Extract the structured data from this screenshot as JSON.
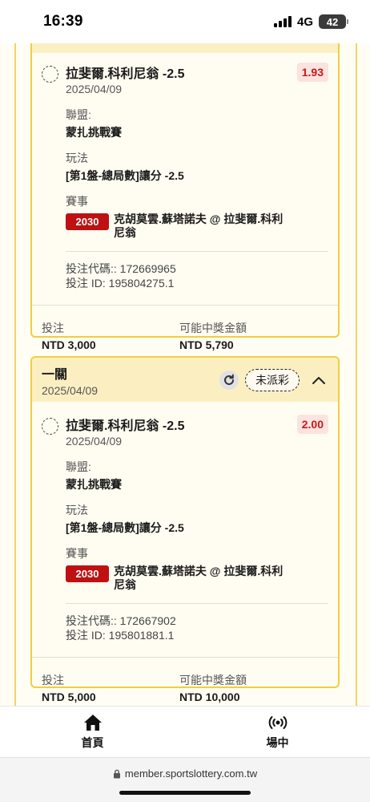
{
  "status_bar": {
    "time": "16:39",
    "network": "4G",
    "battery": "42"
  },
  "bets": [
    {
      "header_title": "",
      "header_date": "",
      "status": "",
      "selection": "拉斐爾.科利尼翁 -2.5",
      "date": "2025/04/09",
      "odds": "1.93",
      "league_label": "聯盟:",
      "league": "蒙扎挑戰賽",
      "market_label": "玩法",
      "market": "[第1盤-總局數]讓分 -2.5",
      "event_label": "賽事",
      "event_time": "2030",
      "event": "克胡莫雲.蘇塔諾夫 @ 拉斐爾.科利尼翁",
      "bet_code": "投注代碼:: 172669965",
      "bet_id": "投注 ID: 195804275.1",
      "stake_label": "投注",
      "stake": "NTD 3,000",
      "payout_label": "可能中獎金額",
      "payout": "NTD 5,790"
    },
    {
      "header_title": "一關",
      "header_date": "2025/04/09",
      "status": "未派彩",
      "selection": "拉斐爾.科利尼翁 -2.5",
      "date": "2025/04/09",
      "odds": "2.00",
      "league_label": "聯盟:",
      "league": "蒙扎挑戰賽",
      "market_label": "玩法",
      "market": "[第1盤-總局數]讓分 -2.5",
      "event_label": "賽事",
      "event_time": "2030",
      "event": "克胡莫雲.蘇塔諾夫 @ 拉斐爾.科利尼翁",
      "bet_code": "投注代碼:: 172667902",
      "bet_id": "投注 ID: 195801881.1",
      "stake_label": "投注",
      "stake": "NTD 5,000",
      "payout_label": "可能中獎金額",
      "payout": "NTD 10,000"
    }
  ],
  "nav": {
    "home": "首頁",
    "live": "場中"
  },
  "url": "member.sportslottery.com.tw",
  "colors": {
    "accent": "#f0cf3c",
    "badge": "#bf1111",
    "odds": "#c61a1a"
  },
  "icons": [
    "refresh-icon",
    "chevron-up-icon",
    "home-icon",
    "broadcast-icon",
    "lock-icon"
  ]
}
